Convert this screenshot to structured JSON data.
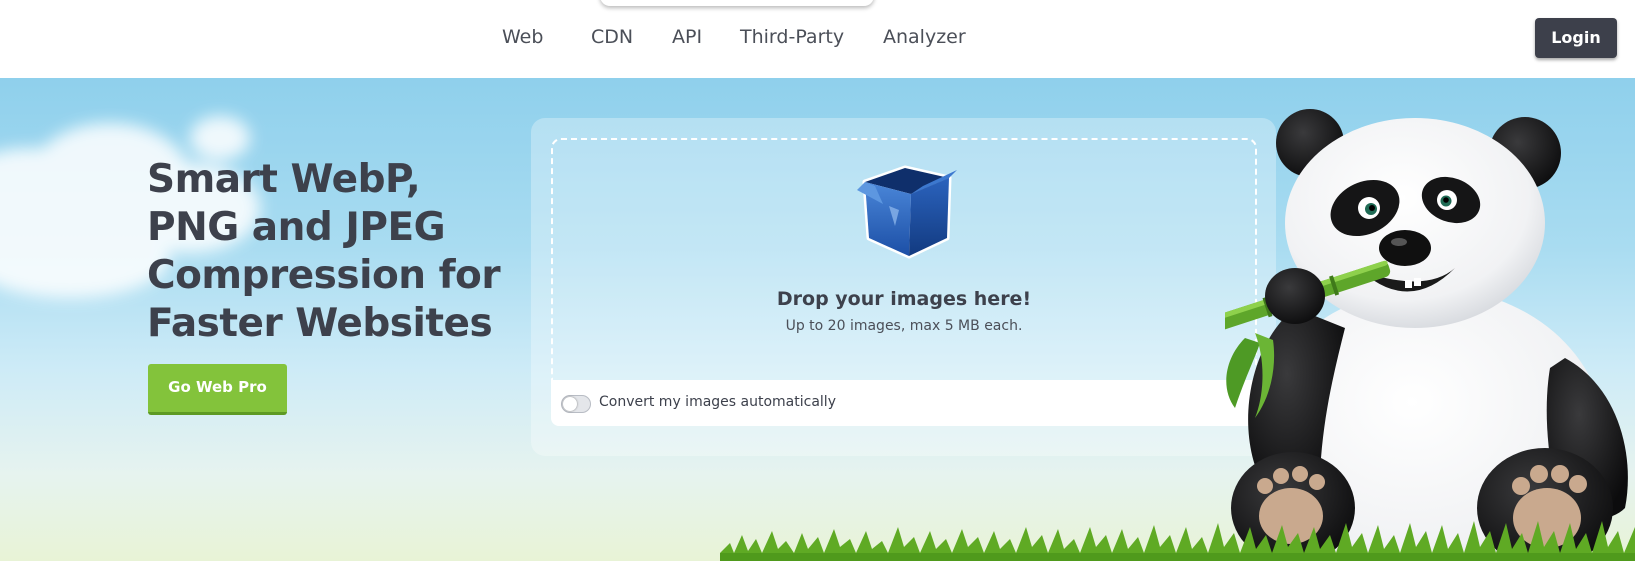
{
  "nav": {
    "items": [
      {
        "label": "Web"
      },
      {
        "label": "CDN"
      },
      {
        "label": "API"
      },
      {
        "label": "Third-Party"
      },
      {
        "label": "Analyzer"
      }
    ],
    "login_label": "Login"
  },
  "hero": {
    "headline": "Smart WebP, PNG and JPEG Compression for Faster Websites",
    "cta_label": "Go Web Pro"
  },
  "upload": {
    "icon": "open-box-icon",
    "title": "Drop your images here!",
    "subtitle": "Up to 20 images, max 5 MB each.",
    "convert_label": "Convert my images automatically",
    "convert_enabled": false
  },
  "colors": {
    "header_bg": "#ffffff",
    "login_bg": "#3d404b",
    "cta_bg": "#83c33b",
    "headline_text": "#3d414c",
    "sky_top": "#8fd0ec",
    "ground": "#e8f3d6"
  },
  "mascot": {
    "icon": "panda-mascot-icon"
  }
}
